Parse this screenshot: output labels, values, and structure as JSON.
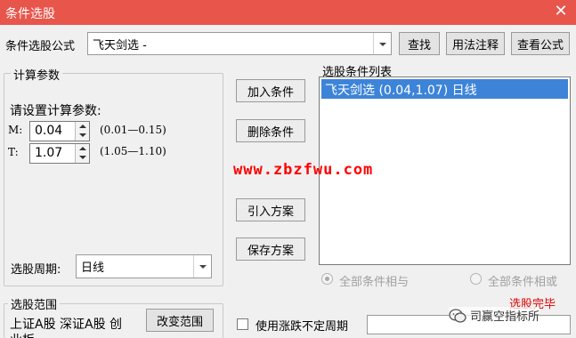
{
  "window": {
    "title": "条件选股",
    "close_glyph": "✕"
  },
  "formula_row": {
    "label": "条件选股公式",
    "selected": "飞天剑选  -",
    "find_button": "查找",
    "usage_button": "用法注释",
    "view_formula_button": "查看公式"
  },
  "params": {
    "group_title": "计算参数",
    "prompt": "请设置计算参数:",
    "m_label": "M:",
    "m_value": "0.04",
    "m_range": "(0.01—0.15)",
    "t_label": "T:",
    "t_value": "1.07",
    "t_range": "(1.05—1.10)",
    "period_label": "选股周期:",
    "period_value": "日线"
  },
  "actions": {
    "add": "加入条件",
    "delete": "删除条件",
    "import": "引入方案",
    "save": "保存方案"
  },
  "conditions": {
    "title": "选股条件列表",
    "items": [
      "飞天剑选 (0.04,1.07) 日线"
    ],
    "radio_and": "全部条件相与",
    "radio_or": "全部条件相或"
  },
  "range": {
    "group_title": "选股范围",
    "text_line1": "上证A股 深证A股 创",
    "text_line2": "业板",
    "change_button": "改变范围"
  },
  "bottom": {
    "floating_period_checkbox": "使用涨跌不定周期",
    "status": "选股完毕"
  },
  "watermark": {
    "text": "www.zbzfwu.com",
    "color": "#ff0000"
  },
  "badge": {
    "text": "司赢空指标所"
  },
  "colors": {
    "titlebar": "#e8554b",
    "selection": "#3d84d9",
    "status": "#e00000"
  }
}
